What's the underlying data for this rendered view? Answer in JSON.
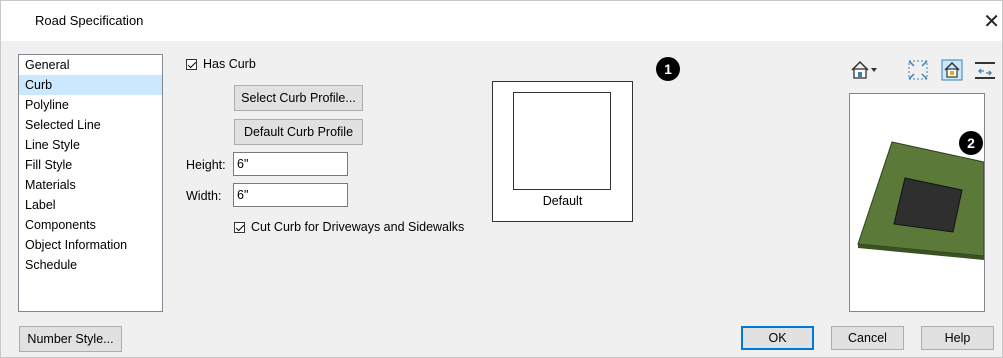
{
  "window": {
    "title": "Road Specification",
    "close_glyph": "✕"
  },
  "sidebar": {
    "items": [
      {
        "label": "General"
      },
      {
        "label": "Curb"
      },
      {
        "label": "Polyline"
      },
      {
        "label": "Selected Line"
      },
      {
        "label": "Line Style"
      },
      {
        "label": "Fill Style"
      },
      {
        "label": "Materials"
      },
      {
        "label": "Label"
      },
      {
        "label": "Components"
      },
      {
        "label": "Object Information"
      },
      {
        "label": "Schedule"
      }
    ],
    "selected": "Curb"
  },
  "curb": {
    "has_curb_label": "Has Curb",
    "has_curb_checked": true,
    "select_profile_label": "Select Curb Profile...",
    "default_profile_label": "Default Curb Profile",
    "height_label": "Height:",
    "height_value": "6\"",
    "width_label": "Width:",
    "width_value": "6\"",
    "cut_curb_label": "Cut Curb for Driveways and Sidewalks",
    "cut_curb_checked": true,
    "preview_label": "Default"
  },
  "callouts": {
    "one": "1",
    "two": "2"
  },
  "footer": {
    "number_style_label": "Number Style...",
    "ok_label": "OK",
    "cancel_label": "Cancel",
    "help_label": "Help"
  },
  "colors": {
    "selection": "#cce8ff",
    "accent": "#0078d7",
    "slab": "#5b7a3a"
  },
  "icons": [
    "house-view-icon",
    "dropdown-arrow-icon",
    "fill-window-icon",
    "house-lock-icon",
    "toggle-view-icon"
  ]
}
